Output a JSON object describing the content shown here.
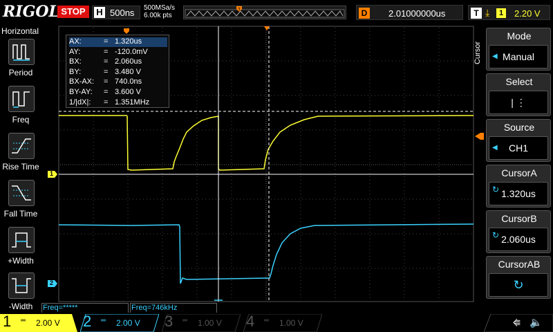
{
  "brand": "RIGOL",
  "run_state": "STOP",
  "timebase": {
    "label": "H",
    "value": "500ns"
  },
  "acquisition": {
    "sample_rate": "500MSa/s",
    "memory_depth": "6.00k pts"
  },
  "delay": {
    "label": "D",
    "value": "2.01000000us"
  },
  "trigger": {
    "label": "T",
    "edge_symbol": "⤓",
    "channel": "1",
    "level": "2.20 V"
  },
  "left_panel": {
    "title": "Horizontal",
    "buttons": [
      {
        "label": "Period",
        "icon": "period-icon"
      },
      {
        "label": "Freq",
        "icon": "freq-icon"
      },
      {
        "label": "Rise Time",
        "icon": "rise-time-icon"
      },
      {
        "label": "Fall Time",
        "icon": "fall-time-icon"
      },
      {
        "label": "+Width",
        "icon": "pos-width-icon"
      },
      {
        "label": "-Width",
        "icon": "neg-width-icon"
      }
    ]
  },
  "cursor_readout": {
    "rows": [
      {
        "key": "AX:",
        "eq": "=",
        "value": "1.320us"
      },
      {
        "key": "AY:",
        "eq": "=",
        "value": "-120.0mV"
      },
      {
        "key": "BX:",
        "eq": "=",
        "value": "2.060us"
      },
      {
        "key": "BY:",
        "eq": "=",
        "value": "3.480 V"
      },
      {
        "key": "BX-AX:",
        "eq": "=",
        "value": "740.0ns"
      },
      {
        "key": "BY-AY:",
        "eq": "=",
        "value": "3.600 V"
      },
      {
        "key": "1/|dX|:",
        "eq": "=",
        "value": "1.351MHz"
      }
    ]
  },
  "channel_markers": {
    "ch1": "1",
    "ch2": "2"
  },
  "freq_counters": {
    "left": "Freq=*****",
    "right": "Freq=746kHz"
  },
  "right_menu": {
    "title": "Cursor",
    "items": [
      {
        "title": "Mode",
        "value": "Manual"
      },
      {
        "title": "Select",
        "value": "|   ⋮"
      },
      {
        "title": "Source",
        "value": "CH1"
      },
      {
        "title": "CursorA",
        "value": "1.320us"
      },
      {
        "title": "CursorB",
        "value": "2.060us"
      },
      {
        "title": "CursorAB",
        "value": "↻"
      }
    ]
  },
  "channels": [
    {
      "num": "1",
      "scale": "2.00 V",
      "coupling": "═",
      "color": "#ffff33",
      "active": true
    },
    {
      "num": "2",
      "scale": "2.00 V",
      "coupling": "═",
      "color": "#3ad2ff",
      "active": true
    },
    {
      "num": "3",
      "scale": "1.00 V",
      "coupling": "═",
      "color": "#555555",
      "active": false
    },
    {
      "num": "4",
      "scale": "1.00 V",
      "coupling": "═",
      "color": "#555555",
      "active": false
    }
  ],
  "status_icons": {
    "usb": "⭅",
    "speaker": "🔈"
  },
  "colors": {
    "ch1": "#ffff33",
    "ch2": "#3ad2ff",
    "trigger": "#ff7f00",
    "stop": "#e01010"
  }
}
